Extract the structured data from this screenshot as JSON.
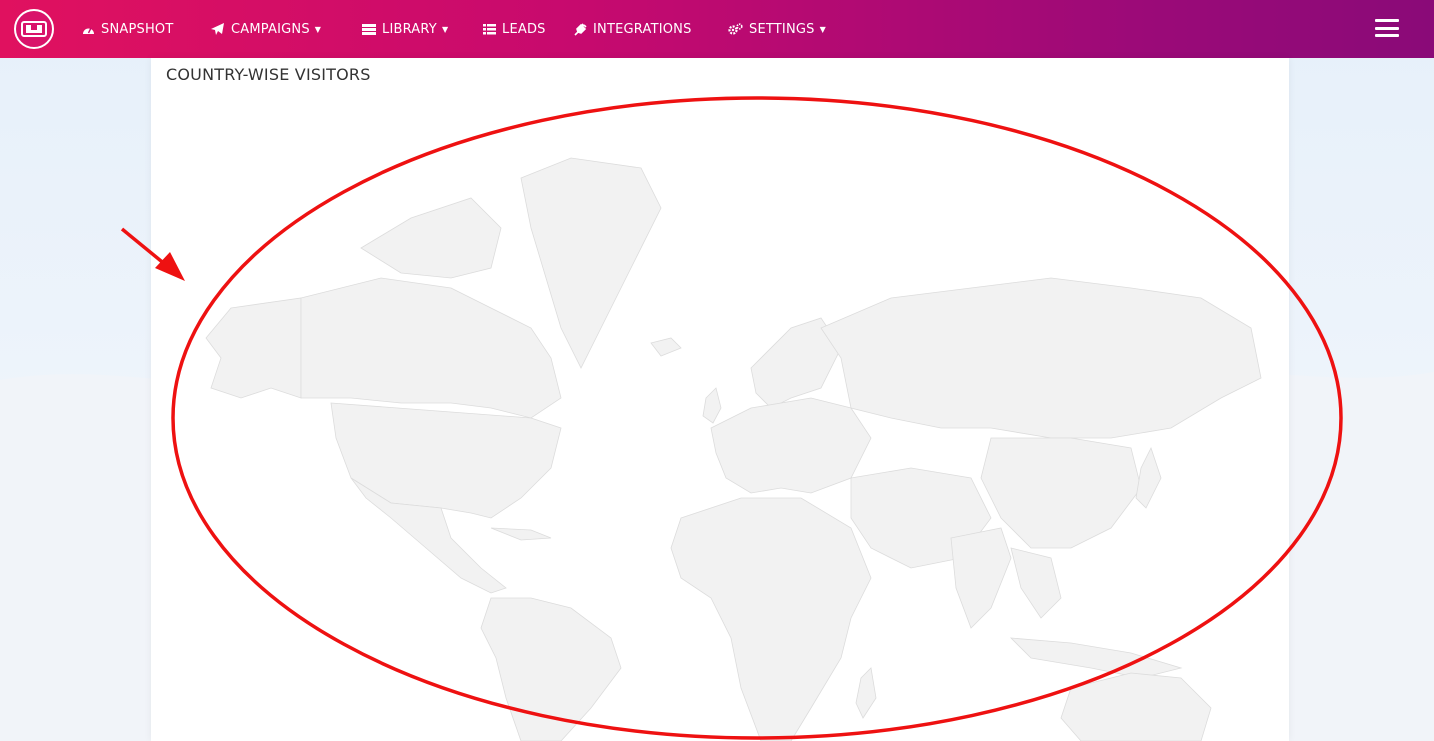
{
  "nav": {
    "items": [
      {
        "label": "SNAPSHOT",
        "icon": "dashboard-icon",
        "dropdown": false
      },
      {
        "label": "CAMPAIGNS",
        "icon": "paper-plane-icon",
        "dropdown": true
      },
      {
        "label": "LIBRARY",
        "icon": "server-icon",
        "dropdown": true
      },
      {
        "label": "LEADS",
        "icon": "list-icon",
        "dropdown": false
      },
      {
        "label": "INTEGRATIONS",
        "icon": "plug-icon",
        "dropdown": false
      },
      {
        "label": "SETTINGS",
        "icon": "cogs-icon",
        "dropdown": true
      }
    ],
    "menu_icon": "hamburger-menu-icon",
    "colors": {
      "gradient_start": "#e0115f",
      "gradient_end": "#8a0a78"
    }
  },
  "panel": {
    "title": "COUNTRY-WISE VISITORS",
    "map_fill": "#f2f2f2",
    "map_stroke": "#dcdcdc"
  },
  "annotation": {
    "color": "#ee1111",
    "shapes": [
      "ellipse-highlight",
      "arrow"
    ]
  }
}
